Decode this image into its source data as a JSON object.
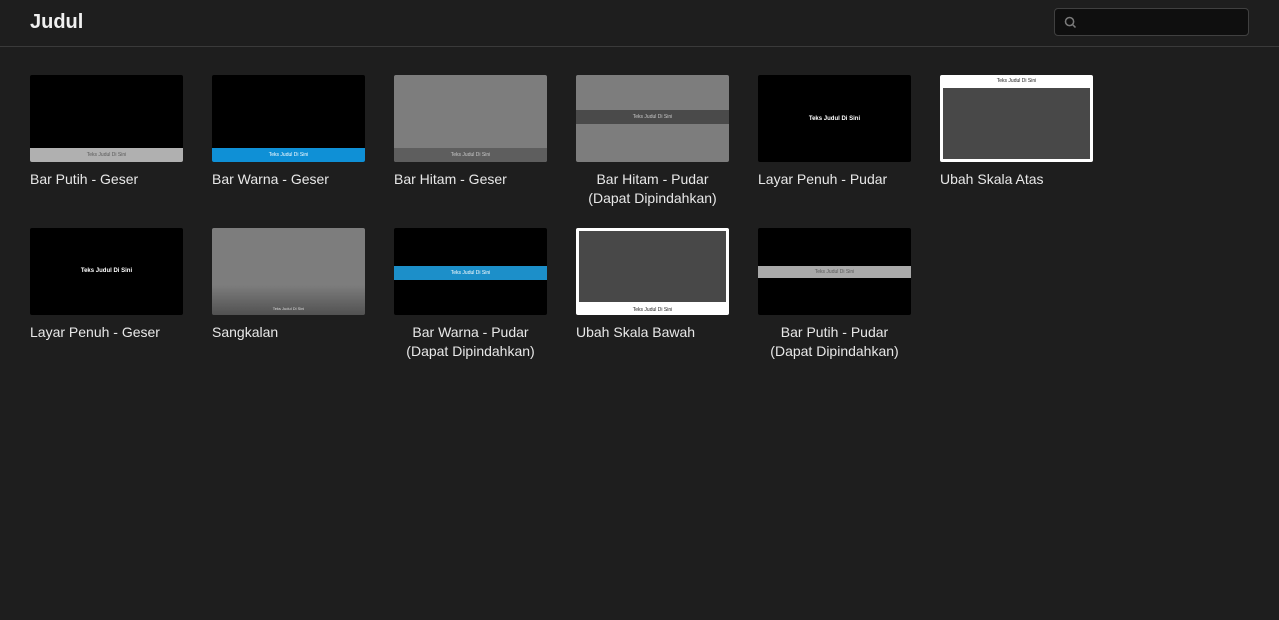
{
  "header": {
    "title": "Judul",
    "search_placeholder": ""
  },
  "sample_text": "Teks Judul Di Sini",
  "tiles": [
    {
      "label": "Bar Putih - Geser"
    },
    {
      "label": "Bar Warna - Geser"
    },
    {
      "label": "Bar Hitam - Geser"
    },
    {
      "label": "Bar Hitam - Pudar (Dapat Dipindahkan)"
    },
    {
      "label": "Layar Penuh - Pudar"
    },
    {
      "label": "Ubah Skala Atas"
    },
    {
      "label": "Layar Penuh - Geser"
    },
    {
      "label": "Sangkalan"
    },
    {
      "label": "Bar Warna - Pudar (Dapat Dipindahkan)"
    },
    {
      "label": "Ubah Skala Bawah"
    },
    {
      "label": "Bar Putih - Pudar (Dapat Dipindahkan)"
    }
  ]
}
